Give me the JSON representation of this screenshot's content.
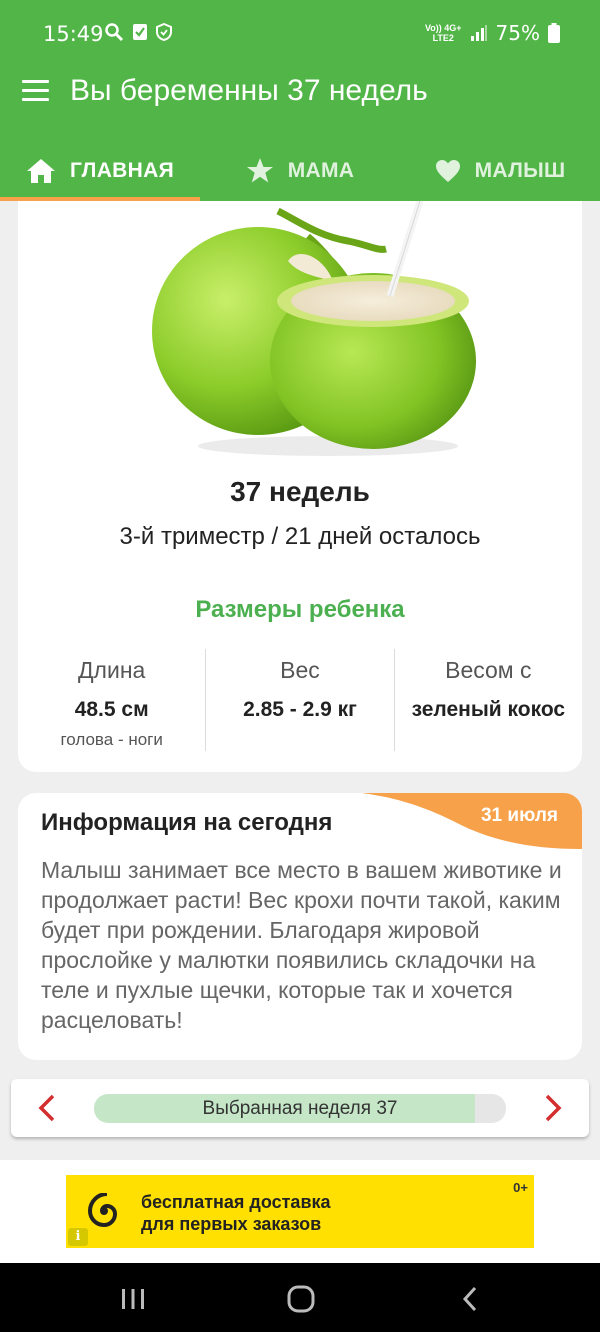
{
  "status_bar": {
    "time": "15:49",
    "battery": "75%",
    "net_top": "Vo)) 4G+",
    "net_bottom": "LTE2"
  },
  "app_bar": {
    "title": "Вы беременны 37 недель",
    "menu_icon": "menu-icon"
  },
  "tabs": [
    {
      "label": "ГЛАВНАЯ",
      "icon": "home-icon",
      "active": true
    },
    {
      "label": "МАМА",
      "icon": "star-icon",
      "active": false
    },
    {
      "label": "МАЛЫШ",
      "icon": "heart-icon",
      "active": false
    }
  ],
  "week_card": {
    "image": "green-coconut",
    "weeks": "37 недель",
    "trimester": "3-й триместр / 21 дней осталось",
    "sizes_title": "Размеры ребенка",
    "stats": [
      {
        "label": "Длина",
        "value": "48.5 см",
        "sub": "голова - ноги"
      },
      {
        "label": "Вес",
        "value": "2.85 - 2.9 кг",
        "sub": ""
      },
      {
        "label": "Весом с",
        "value": "зеленый кокос",
        "sub": ""
      }
    ]
  },
  "info_card": {
    "title": "Информация на сегодня",
    "date": "31 июля",
    "body": "Малыш занимает все место в вашем животике и продолжает расти! Вес крохи почти такой, каким будет при рождении. Благодаря жировой прослойке у малютки появились складочки на теле и пухлые щечки, которые так и хочется расцеловать!"
  },
  "week_selector": {
    "label": "Выбранная неделя 37",
    "progress": 0.925,
    "prev_icon": "chevron-left-icon",
    "next_icon": "chevron-right-icon"
  },
  "ad": {
    "line1": "бесплатная доставка",
    "line2": "для первых заказов",
    "age": "0+",
    "info": "i"
  },
  "colors": {
    "primary": "#52b548",
    "accent": "#f7a14a",
    "green_text": "#4caf50",
    "nav_arrow": "#d32f2f",
    "ad_bg": "#ffe000"
  }
}
